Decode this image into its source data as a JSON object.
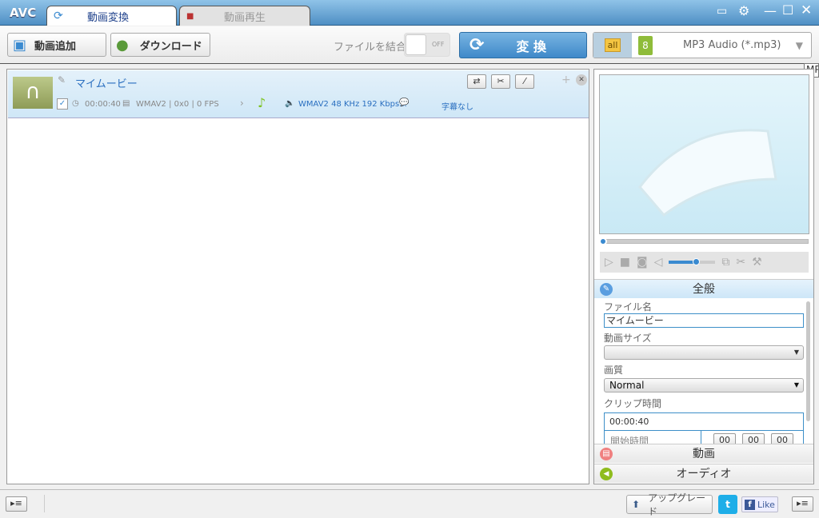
{
  "app": {
    "logo": "AVC",
    "tabs": [
      {
        "label": "動画変換",
        "active": true
      },
      {
        "label": "動画再生",
        "active": false
      }
    ]
  },
  "toolbar": {
    "add_video": "動画追加",
    "download": "ダウンロード",
    "merge_label": "ファイルを結合",
    "merge_toggle": "OFF",
    "convert": "変 換",
    "profile": "MP3 Audio (*.mp3)",
    "profile_badge": "all",
    "tooltip": "MP"
  },
  "item": {
    "name": "マイムービー",
    "duration": "00:00:40",
    "video_info": "WMAV2 | 0x0 | 0 FPS",
    "audio_info": "WMAV2 48 KHz 192 Kbps...",
    "subtitle": "字幕なし",
    "checked": true
  },
  "panel": {
    "general": "全般",
    "file_name_label": "ファイル名",
    "file_name": "マイムービー",
    "video_size_label": "動画サイズ",
    "video_size": "",
    "quality_label": "画質",
    "quality": "Normal",
    "clip_label": "クリップ時間",
    "clip_duration": "00:00:40",
    "start_label": "開始時間",
    "start_h": "00",
    "start_m": "00",
    "start_s": "00",
    "video_section": "動画",
    "audio_section": "オーディオ",
    "volume": 0.6,
    "seek": 0
  },
  "status": {
    "upgrade": "アップグレード",
    "like": "Like"
  },
  "colors": {
    "accent": "#3f89c9",
    "titlebar": "#5f9fd2"
  }
}
